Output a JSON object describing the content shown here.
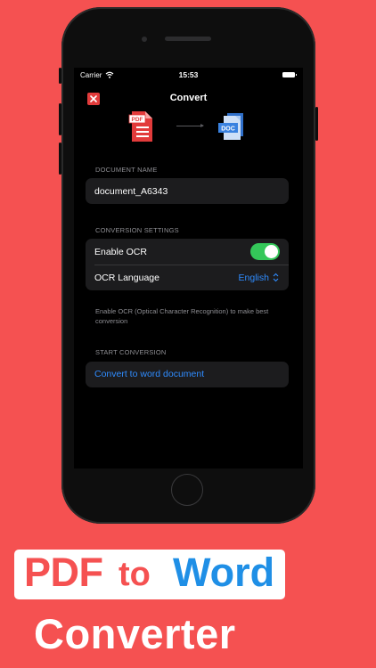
{
  "status_bar": {
    "carrier": "Carrier",
    "time": "15:53"
  },
  "nav": {
    "title": "Convert",
    "close_icon": "close-icon"
  },
  "conversion_graphic": {
    "from_label": "PDF",
    "to_label": "DOC"
  },
  "document_name": {
    "header": "DOCUMENT NAME",
    "value": "document_A6343"
  },
  "conversion_settings": {
    "header": "CONVERSION SETTINGS",
    "enable_ocr_label": "Enable OCR",
    "enable_ocr_on": true,
    "ocr_language_label": "OCR Language",
    "ocr_language_value": "English",
    "footnote": "Enable OCR (Optical Character Recognition) to make best conversion"
  },
  "start_conversion": {
    "header": "START CONVERSION",
    "action_label": "Convert to word document"
  },
  "promo": {
    "pdf": "PDF",
    "to": "to",
    "word": "Word",
    "converter": "Converter"
  },
  "colors": {
    "background": "#f55151",
    "accent_blue": "#2f8cff",
    "toggle_green": "#34c759",
    "close_red": "#e23b3b",
    "promo_word_blue": "#1f8fe6"
  }
}
